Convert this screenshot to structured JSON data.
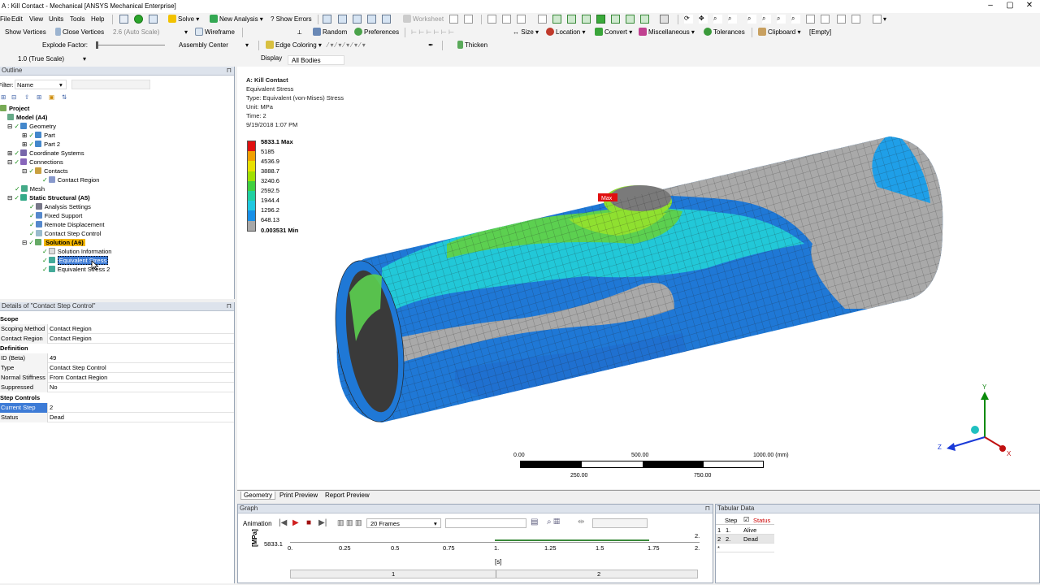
{
  "window": {
    "title": "A : Kill Contact - Mechanical [ANSYS Mechanical Enterprise]"
  },
  "menu": {
    "items": [
      "File",
      "Edit",
      "View",
      "Units",
      "Tools",
      "Help"
    ]
  },
  "toolbar1": {
    "solve": "Solve",
    "new_analysis": "New Analysis",
    "show_errors": "Show Errors",
    "worksheet": "Worksheet"
  },
  "toolbar2": {
    "show_vertices": "Show Vertices",
    "close_vertices": "Close Vertices",
    "auto_scale": "2.6 (Auto Scale)",
    "wireframe": "Wireframe",
    "random": "Random",
    "preferences": "Preferences",
    "size": "Size",
    "location": "Location",
    "convert": "Convert",
    "miscellaneous": "Miscellaneous",
    "tolerances": "Tolerances",
    "clipboard": "Clipboard",
    "empty": "[Empty]"
  },
  "toolbar3": {
    "explode_factor": "Explode Factor:",
    "assembly_center": "Assembly Center",
    "edge_coloring": "Edge Coloring",
    "thicken": "Thicken"
  },
  "toolbar4": {
    "scale": "1.0 (True Scale)",
    "display": "Display",
    "all_bodies": "All Bodies"
  },
  "outline": {
    "header": "Outline",
    "filter_label": "Filter:",
    "filter_value": "Name",
    "tree": {
      "project": "Project",
      "model": "Model (A4)",
      "geometry": "Geometry",
      "part": "Part",
      "part2": "Part 2",
      "coord": "Coordinate Systems",
      "connections": "Connections",
      "contacts": "Contacts",
      "contact_region": "Contact Region",
      "mesh": "Mesh",
      "static": "Static Structural (A5)",
      "analysis_settings": "Analysis Settings",
      "fixed_support": "Fixed Support",
      "remote_disp": "Remote Displacement",
      "contact_step": "Contact Step Control",
      "solution": "Solution (A6)",
      "solution_info": "Solution Information",
      "eq_stress": "Equivalent Stress",
      "eq_stress2": "Equivalent Stress 2"
    }
  },
  "details": {
    "header": "Details of \"Contact Step Control\"",
    "scope": "Scope",
    "definition": "Definition",
    "step_controls": "Step Controls",
    "rows": [
      {
        "k": "Scoping Method",
        "v": "Contact Region"
      },
      {
        "k": "Contact Region",
        "v": "Contact Region"
      },
      {
        "k": "ID (Beta)",
        "v": "49"
      },
      {
        "k": "Type",
        "v": "Contact Step Control"
      },
      {
        "k": "Normal Stiffness",
        "v": "From Contact Region"
      },
      {
        "k": "Suppressed",
        "v": "No"
      },
      {
        "k": "Current Step",
        "v": "2"
      },
      {
        "k": "Status",
        "v": "Dead"
      }
    ]
  },
  "result": {
    "name": "A: Kill Contact",
    "quantity": "Equivalent Stress",
    "type": "Type: Equivalent (von-Mises) Stress",
    "unit": "Unit: MPa",
    "time": "Time: 2",
    "date": "9/19/2018 1:07 PM",
    "max_tag": "Max",
    "legend": [
      "5833.1 Max",
      "5185",
      "4536.9",
      "3888.7",
      "3240.6",
      "2592.5",
      "1944.4",
      "1296.2",
      "648.13",
      "0.003531 Min"
    ],
    "legend_colors": [
      "#e01010",
      "#f0a000",
      "#e8e000",
      "#a0e000",
      "#40d040",
      "#20d0a0",
      "#20c8e0",
      "#1890e8",
      "#2050d8",
      "#a8a8a8"
    ],
    "scale": {
      "t0": "0.00",
      "t1": "500.00",
      "t2": "1000.00 (mm)",
      "b1": "250.00",
      "b2": "750.00"
    },
    "axis": {
      "y": "Y",
      "z": "Z",
      "x": "X"
    }
  },
  "tabs": {
    "geometry": "Geometry",
    "print": "Print Preview",
    "report": "Report Preview"
  },
  "graph": {
    "header": "Graph",
    "animation": "Animation",
    "frames": "20 Frames",
    "ylabel": "[MPa]",
    "yval": "5833.1",
    "xlabel": "[s]",
    "xticks": [
      "0.",
      "0.25",
      "0.5",
      "0.75",
      "1.",
      "1.25",
      "1.5",
      "1.75",
      "2."
    ],
    "end_label": "2.",
    "steps": [
      "1",
      "2"
    ]
  },
  "tabular": {
    "header": "Tabular Data",
    "col_step": "Step",
    "col_status": "Status",
    "rows": [
      {
        "n": "1",
        "step": "1.",
        "status": "Alive"
      },
      {
        "n": "2",
        "step": "2.",
        "status": "Dead"
      }
    ],
    "star": "*"
  }
}
